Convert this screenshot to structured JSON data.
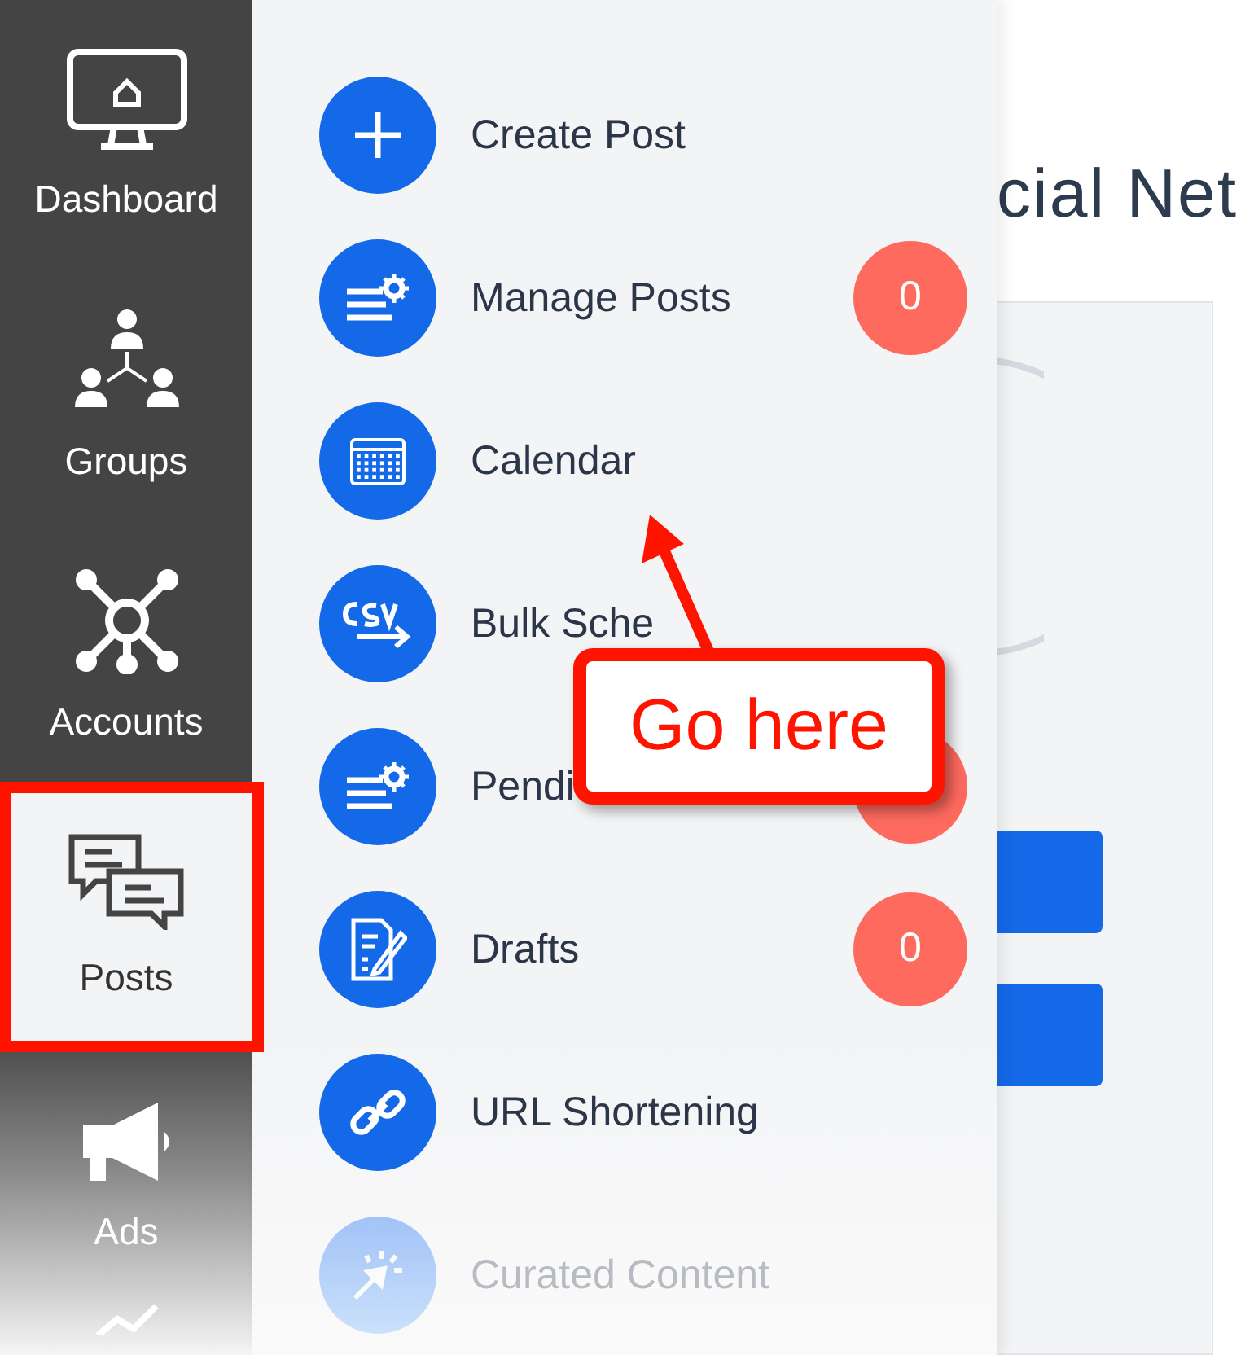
{
  "sidebar": {
    "items": [
      {
        "label": "Dashboard",
        "selected": false
      },
      {
        "label": "Groups",
        "selected": false
      },
      {
        "label": "Accounts",
        "selected": false
      },
      {
        "label": "Posts",
        "selected": true
      },
      {
        "label": "Ads",
        "selected": false
      }
    ]
  },
  "submenu": {
    "items": [
      {
        "label": "Create Post",
        "disabled": false
      },
      {
        "label": "Manage Posts",
        "badge": "0",
        "disabled": false
      },
      {
        "label": "Calendar",
        "disabled": false
      },
      {
        "label": "Bulk Sche",
        "disabled": false
      },
      {
        "label": "Pendi",
        "has_badge": true,
        "disabled": false
      },
      {
        "label": "Drafts",
        "badge": "0",
        "disabled": false
      },
      {
        "label": "URL Shortening",
        "disabled": false
      },
      {
        "label": "Curated Content",
        "disabled": true
      }
    ]
  },
  "page": {
    "heading": "cial Net"
  },
  "callout": {
    "text": "Go here"
  }
}
